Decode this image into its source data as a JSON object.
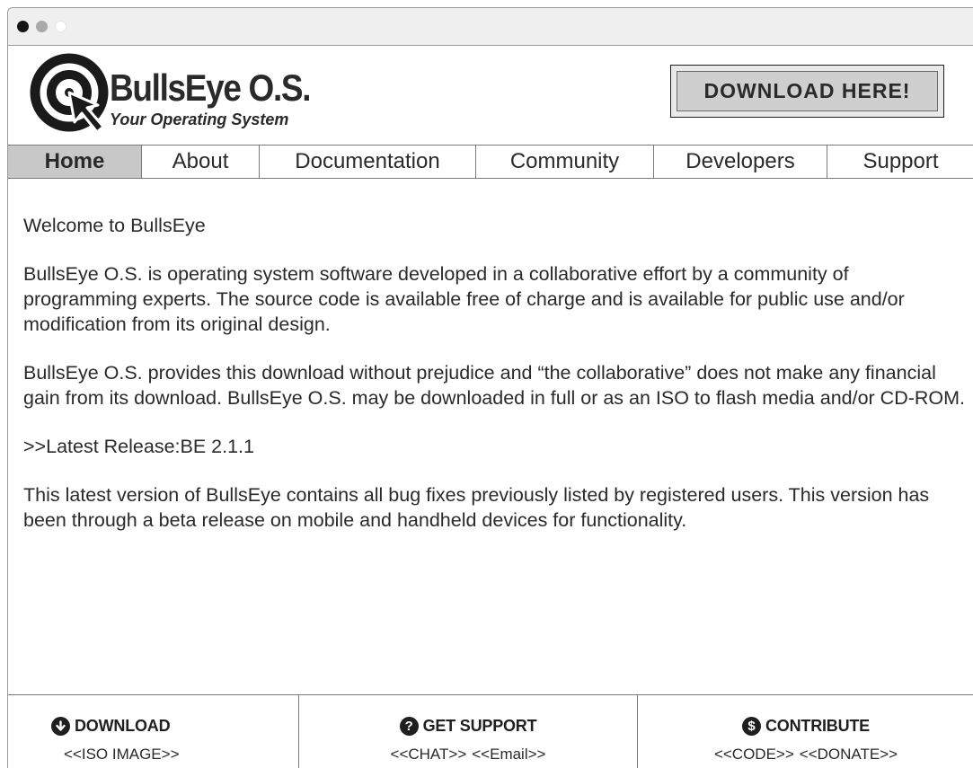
{
  "window": {
    "controls": [
      "close-dot",
      "minimize-dot",
      "maximize-dot"
    ]
  },
  "header": {
    "brand_name": "BullsEye O.S.",
    "tagline": "Your Operating System",
    "download_label": "DOWNLOAD HERE!"
  },
  "nav": {
    "items": [
      {
        "label": "Home",
        "active": true
      },
      {
        "label": "About",
        "active": false
      },
      {
        "label": "Documentation",
        "active": false
      },
      {
        "label": "Community",
        "active": false
      },
      {
        "label": "Developers",
        "active": false
      },
      {
        "label": "Support",
        "active": false
      }
    ]
  },
  "content": {
    "welcome": "Welcome to BullsEye",
    "intro": "BullsEye O.S. is operating system software developed in a collaborative effort by a community of programming experts. The source code is available free of charge and is available for public use and/or modification from its original design.",
    "disclaimer": "BullsEye O.S. provides this download without prejudice and “the collaborative” does not make any financial gain from its download. BullsEye O.S. may be downloaded in full or as an ISO to flash media and/or CD-ROM.",
    "latest_release": ">>Latest Release:BE 2.1.1",
    "release_notes": "This latest version of BullsEye contains all bug fixes previously listed by registered users. This version has been through a beta release on mobile and handheld devices for functionality."
  },
  "footer": {
    "download": {
      "icon": "download-arrow-icon",
      "title": "DOWNLOAD",
      "links": [
        "<<ISO IMAGE>>"
      ]
    },
    "support": {
      "icon": "question-icon",
      "title": "GET SUPPORT",
      "links": [
        "<<CHAT>>",
        "<<Email>>"
      ]
    },
    "contribute": {
      "icon": "dollar-icon",
      "title": "CONTRIBUTE",
      "links": [
        "<<CODE>>",
        "<<DONATE>>"
      ]
    }
  },
  "colors": {
    "active_tab": "#c8c8c8",
    "button_face": "#cfcfcf",
    "text": "#2a2a2a",
    "border": "#7a7a7a"
  }
}
